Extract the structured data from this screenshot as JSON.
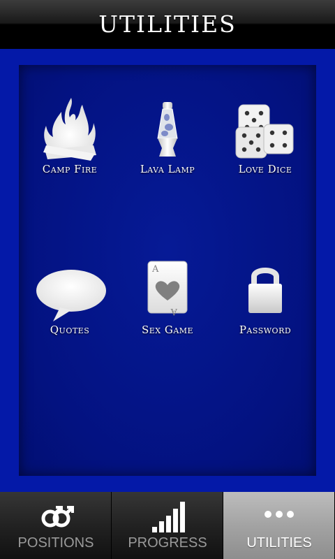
{
  "header": {
    "title": "UTILITIES"
  },
  "utilities": [
    {
      "label": "Camp Fire",
      "icon": "campfire-icon"
    },
    {
      "label": "Lava Lamp",
      "icon": "lava-lamp-icon"
    },
    {
      "label": "Love Dice",
      "icon": "dice-icon"
    },
    {
      "label": "Quotes",
      "icon": "speech-bubble-icon"
    },
    {
      "label": "Sex Game",
      "icon": "playing-card-icon"
    },
    {
      "label": "Password",
      "icon": "lock-icon"
    }
  ],
  "card": {
    "rank": "A"
  },
  "tabs": [
    {
      "label": "POSITIONS",
      "icon": "gender-symbols-icon",
      "active": false
    },
    {
      "label": "PROGRESS",
      "icon": "bar-chart-icon",
      "active": false
    },
    {
      "label": "UTILITIES",
      "icon": "more-dots-icon",
      "active": true
    }
  ],
  "colors": {
    "background": "#0419a8",
    "panel": "#031281",
    "active_tab": "#a3a3a3"
  }
}
